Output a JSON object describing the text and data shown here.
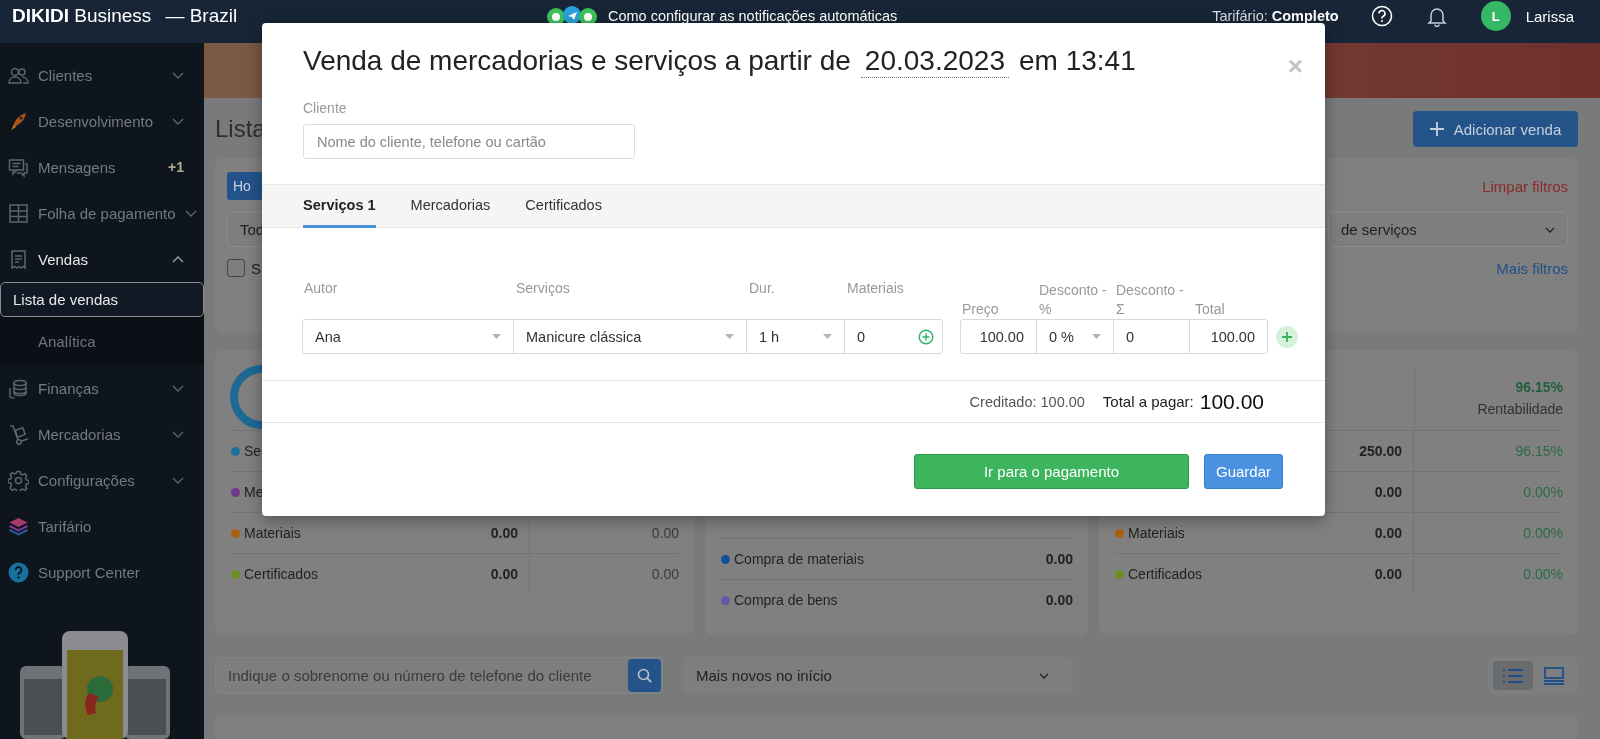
{
  "topbar": {
    "brand": "**DIKIDI** Business",
    "region": "— Brazil",
    "notice": "Como configurar as notificações automáticas",
    "plan": "Tarifário: **Completo**",
    "avatar": "L",
    "user": "Larissa"
  },
  "sidebar": {
    "items": [
      {
        "label": "Clientes",
        "kind": "group",
        "expanded": false
      },
      {
        "label": "Desenvolvimento",
        "kind": "group",
        "expanded": false
      },
      {
        "label": "Mensagens",
        "kind": "link",
        "badge": "+1"
      },
      {
        "label": "Folha de pagamento",
        "kind": "group",
        "expanded": false
      },
      {
        "label": "Vendas",
        "kind": "group",
        "expanded": true,
        "children": [
          {
            "label": "Lista de vendas",
            "selected": true
          },
          {
            "label": "Analítica",
            "selected": false
          }
        ]
      },
      {
        "label": "Finanças",
        "kind": "group",
        "expanded": false
      },
      {
        "label": "Mercadorias",
        "kind": "group",
        "expanded": false
      },
      {
        "label": "Configurações",
        "kind": "group",
        "expanded": false
      },
      {
        "label": "Tarifário",
        "kind": "link"
      },
      {
        "label": "Support Center",
        "kind": "link"
      }
    ]
  },
  "main": {
    "title": "Lista",
    "add_button": "Adicionar venda",
    "filters": {
      "period_button": "Ho",
      "clear_link": "Limpar filtros",
      "select_left": "Tod",
      "select_right": "de serviços",
      "checkbox": {
        "label": "S",
        "checked": false
      },
      "more_link": "Mais filtros"
    },
    "cards": [
      {
        "kind": "income",
        "rows": [
          {
            "label": "Se",
            "color": "#1f6e9c"
          },
          {
            "label": "Me",
            "color": "#6e3787"
          },
          {
            "label": "Materiais",
            "color": "#a8620f",
            "values": [
              "0.00",
              "0.00"
            ]
          },
          {
            "label": "Certificados",
            "color": "#6b8f22",
            "values": [
              "0.00",
              "0.00"
            ]
          }
        ]
      },
      {
        "kind": "expenses",
        "rows": [
          {
            "label": "Compra de materiais",
            "color": "#14509a",
            "values": [
              "0.00"
            ]
          },
          {
            "label": "Compra de bens",
            "color": "#6656a8",
            "values": [
              "0.00"
            ]
          }
        ]
      },
      {
        "kind": "profit",
        "summary": {
          "value": "96.15%",
          "label": "Rentabilidade"
        },
        "rows": [
          {
            "values": [
              "250.00",
              "96.15%"
            ]
          },
          {
            "values": [
              "0.00",
              "0.00%"
            ]
          },
          {
            "label": "Materiais",
            "color": "#a8620f",
            "values": [
              "0.00",
              "0.00%"
            ]
          },
          {
            "label": "Certificados",
            "color": "#6b8f22",
            "values": [
              "0.00",
              "0.00%"
            ]
          }
        ]
      }
    ],
    "search": {
      "placeholder": "Indique o sobrenome ou número de telefone do cliente"
    },
    "sort": "Mais novos no início",
    "views": [
      {
        "kind": "list",
        "selected": true
      },
      {
        "kind": "cards",
        "selected": false
      }
    ]
  },
  "modal": {
    "title": "Venda de mercadorias e serviços a partir de",
    "date": "20.03.2023",
    "time": "em 13:41",
    "close": "×",
    "client": {
      "label": "Cliente",
      "placeholder": "Nome do cliente, telefone ou cartão"
    },
    "tabs": [
      {
        "label": "Serviços 1",
        "selected": true
      },
      {
        "label": "Mercadorias",
        "selected": false
      },
      {
        "label": "Certificados",
        "selected": false
      }
    ],
    "columns": [
      "Autor",
      "Serviços",
      "Dur.",
      "Materiais",
      "Preço",
      "Desconto - %",
      "Desconto - Σ",
      "Total"
    ],
    "rows": [
      {
        "author": "Ana",
        "service": "Manicure clássica",
        "duration": "1 h",
        "materials": "0",
        "price": "100.00",
        "discount_pct": "0 %",
        "discount_sum": "0",
        "total": "100.00"
      }
    ],
    "credited": "Creditado: 100.00",
    "total_label": "Total a pagar:",
    "total": "100.00",
    "buttons": [
      {
        "label": "Ir para o pagamento",
        "kind": "primary"
      },
      {
        "label": "Guardar",
        "kind": "secondary"
      }
    ]
  }
}
